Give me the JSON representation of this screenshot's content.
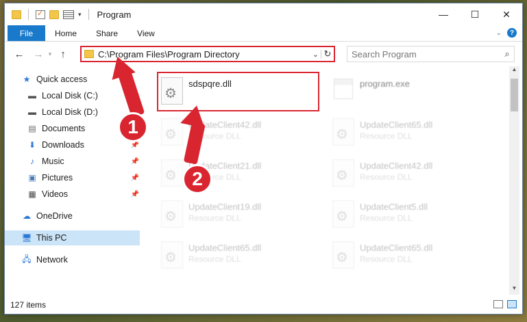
{
  "window": {
    "title": "Program"
  },
  "ribbon": {
    "tabs": [
      "File",
      "Home",
      "Share",
      "View"
    ]
  },
  "window_controls": {
    "minimize": "—",
    "maximize": "☐",
    "close": "✕"
  },
  "address": {
    "path": "C:\\Program Files\\Program Directory",
    "refresh": "↻",
    "dropdown": "⌄"
  },
  "search": {
    "placeholder": "Search Program",
    "icon": "⌕"
  },
  "sidebar": {
    "items": [
      {
        "label": "Quick access",
        "icon": "star-icon",
        "pinned": false
      },
      {
        "label": "Local Disk (C:)",
        "icon": "drive-icon",
        "pinned": true
      },
      {
        "label": "Local Disk (D:)",
        "icon": "drive-icon",
        "pinned": true
      },
      {
        "label": "Documents",
        "icon": "documents-icon",
        "pinned": true
      },
      {
        "label": "Downloads",
        "icon": "download-icon",
        "pinned": true
      },
      {
        "label": "Music",
        "icon": "music-icon",
        "pinned": true
      },
      {
        "label": "Pictures",
        "icon": "pictures-icon",
        "pinned": true
      },
      {
        "label": "Videos",
        "icon": "videos-icon",
        "pinned": true
      },
      {
        "label": "OneDrive",
        "icon": "cloud-icon",
        "pinned": false
      },
      {
        "label": "This PC",
        "icon": "pc-icon",
        "pinned": false,
        "selected": true
      },
      {
        "label": "Network",
        "icon": "network-icon",
        "pinned": false
      }
    ]
  },
  "files": {
    "highlighted": {
      "name": "sdspqre.dll"
    },
    "exe": {
      "name": "program.exe"
    },
    "left_column": [
      {
        "name": "UpdateClient42.dll",
        "type": "Resource DLL"
      },
      {
        "name": "UpdateClient21.dll",
        "type": "Resource DLL"
      },
      {
        "name": "UpdateClient19.dll",
        "type": "Resource DLL"
      },
      {
        "name": "UpdateClient65.dll",
        "type": "Resource DLL"
      }
    ],
    "right_column": [
      {
        "name": "UpdateClient65.dll",
        "type": "Resource DLL"
      },
      {
        "name": "UpdateClient42.dll",
        "type": "Resource DLL"
      },
      {
        "name": "UpdateClient5.dll",
        "type": "Resource DLL"
      },
      {
        "name": "UpdateClient65.dll",
        "type": "Resource DLL"
      }
    ]
  },
  "status": {
    "item_count": "127 items"
  },
  "annotations": {
    "badge1": "1",
    "badge2": "2",
    "color": "#d9252f"
  }
}
